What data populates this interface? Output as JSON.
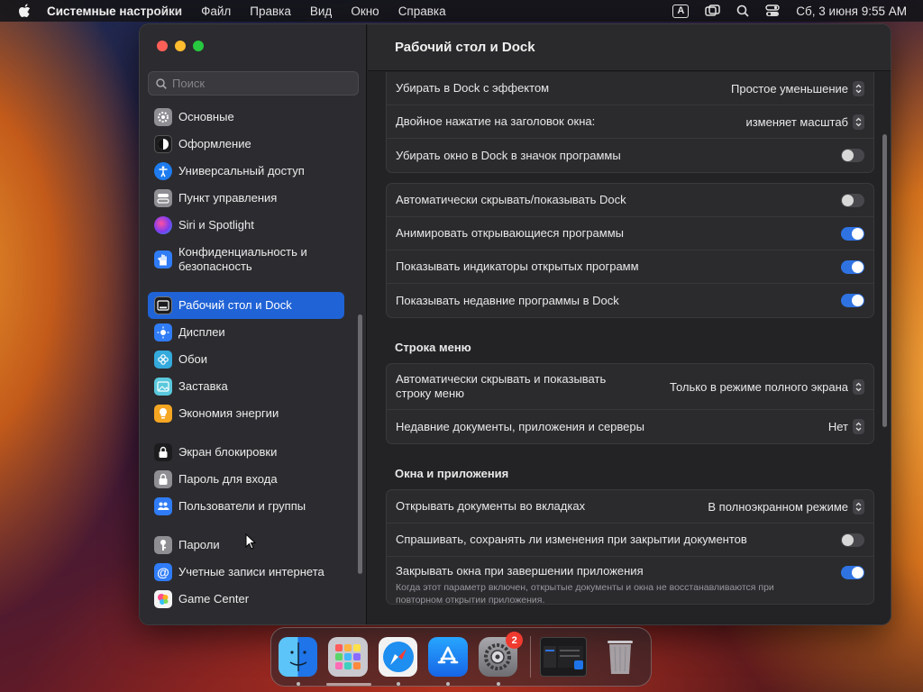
{
  "menubar": {
    "app_name": "Системные настройки",
    "items": [
      "Файл",
      "Правка",
      "Вид",
      "Окно",
      "Справка"
    ],
    "input_indicator": "A",
    "datetime": "Сб, 3 июня  9:55 AM"
  },
  "sidebar": {
    "search_placeholder": "Поиск",
    "items": [
      {
        "label": "Основные",
        "icon": "gear-icon",
        "color": "#8e8e93"
      },
      {
        "label": "Оформление",
        "icon": "appearance-icon",
        "color": "#1c1c1e"
      },
      {
        "label": "Универсальный доступ",
        "icon": "accessibility-icon",
        "color": "#1e7cf0"
      },
      {
        "label": "Пункт управления",
        "icon": "control-center-icon",
        "color": "#8e8e93"
      },
      {
        "label": "Siri и Spotlight",
        "icon": "siri-icon",
        "color": "#b040d0"
      },
      {
        "label": "Конфиденциальность и безопасность",
        "icon": "hand-icon",
        "color": "#2f7cf6"
      },
      {
        "label": "Рабочий стол и Dock",
        "icon": "dock-icon",
        "color": "#1c1c1e"
      },
      {
        "label": "Дисплеи",
        "icon": "display-icon",
        "color": "#2f7cf6"
      },
      {
        "label": "Обои",
        "icon": "wallpaper-icon",
        "color": "#35aadc"
      },
      {
        "label": "Заставка",
        "icon": "screensaver-icon",
        "color": "#5ac8dc"
      },
      {
        "label": "Экономия энергии",
        "icon": "bulb-icon",
        "color": "#f5a623"
      },
      {
        "label": "Экран блокировки",
        "icon": "lock-screen-icon",
        "color": "#1c1c1e"
      },
      {
        "label": "Пароль для входа",
        "icon": "lock-icon",
        "color": "#8e8e93"
      },
      {
        "label": "Пользователи и группы",
        "icon": "users-icon",
        "color": "#2f7cf6"
      },
      {
        "label": "Пароли",
        "icon": "key-icon",
        "color": "#8e8e93"
      },
      {
        "label": "Учетные записи интернета",
        "icon": "at-icon",
        "color": "#2f7cf6"
      },
      {
        "label": "Game Center",
        "icon": "game-center-icon",
        "color": "#ffffff"
      }
    ]
  },
  "main": {
    "title": "Рабочий стол и Dock",
    "group1": [
      {
        "label": "Убирать в Dock с эффектом",
        "value": "Простое уменьшение"
      },
      {
        "label": "Двойное нажатие на заголовок окна:",
        "value": "изменяет масштаб"
      },
      {
        "label": "Убирать окно в Dock в значок программы",
        "toggle": false
      }
    ],
    "group2": [
      {
        "label": "Автоматически скрывать/показывать Dock",
        "toggle": false
      },
      {
        "label": "Анимировать открывающиеся программы",
        "toggle": true
      },
      {
        "label": "Показывать индикаторы открытых программ",
        "toggle": true
      },
      {
        "label": "Показывать недавние программы в Dock",
        "toggle": true
      }
    ],
    "menu_bar_section": "Строка меню",
    "group3": [
      {
        "label": "Автоматически скрывать и показывать строку меню",
        "value": "Только в режиме полного экрана"
      },
      {
        "label": "Недавние документы, приложения и серверы",
        "value": "Нет"
      }
    ],
    "windows_section": "Окна и приложения",
    "group4": [
      {
        "label": "Открывать документы во вкладках",
        "value": "В полноэкранном режиме"
      },
      {
        "label": "Спрашивать, сохранять ли изменения при закрытии документов",
        "toggle": false
      },
      {
        "label": "Закрывать окна при завершении приложения",
        "toggle": true,
        "description": "Когда этот параметр включен, открытые документы и окна не восстанавливаются при повторном открытии приложения."
      }
    ]
  },
  "dock": {
    "apps": [
      "finder-icon",
      "launchpad-icon",
      "safari-icon",
      "app-store-icon",
      "system-settings-icon"
    ],
    "settings_badge": "2"
  }
}
